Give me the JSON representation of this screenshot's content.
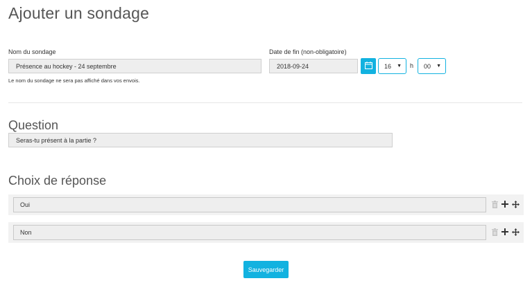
{
  "page": {
    "title": "Ajouter un sondage"
  },
  "poll_name": {
    "label": "Nom du sondage",
    "value": "Présence au hockey - 24 septembre",
    "hint": "Le nom du sondage ne sera pas affiché dans vos envois."
  },
  "end_date": {
    "label": "Date de fin (non-obligatoire)",
    "date_value": "2018-09-24",
    "hour_value": "16",
    "hour_separator": "h",
    "minute_value": "00"
  },
  "question": {
    "title": "Question",
    "value": "Seras-tu présent à la partie ?"
  },
  "choices": {
    "title": "Choix de réponse",
    "items": [
      {
        "value": "Oui"
      },
      {
        "value": "Non"
      }
    ]
  },
  "actions": {
    "save_label": "Sauvegarder"
  },
  "colors": {
    "accent": "#12b2e0"
  },
  "icons": {
    "calendar": "calendar-icon",
    "delete": "trash-icon",
    "add": "plus-icon",
    "move": "move-icon",
    "dropdown": "caret-down-icon"
  }
}
